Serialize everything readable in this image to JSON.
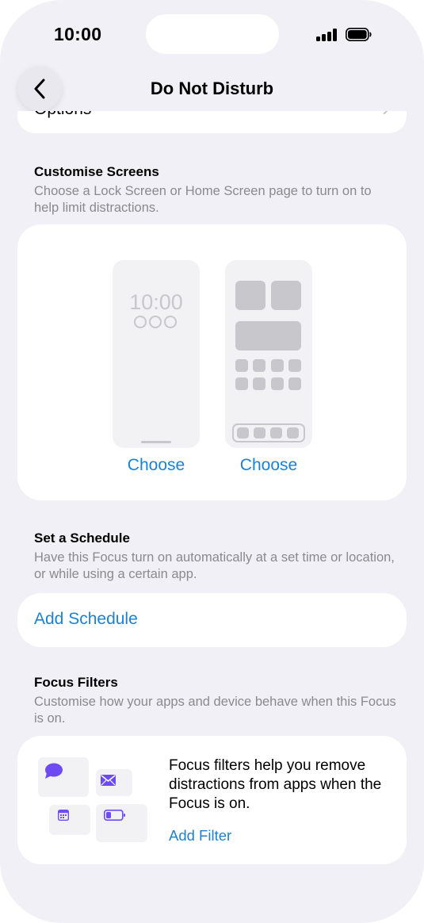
{
  "status": {
    "time": "10:00"
  },
  "nav": {
    "title": "Do Not Disturb"
  },
  "top_card": {
    "label": "Options"
  },
  "customise": {
    "title": "Customise Screens",
    "description": "Choose a Lock Screen or Home Screen page to turn on to help limit distractions.",
    "lock_time": "10:00",
    "choose_lock": "Choose",
    "choose_home": "Choose"
  },
  "schedule": {
    "title": "Set a Schedule",
    "description": "Have this Focus turn on automatically at a set time or location, or while using a certain app.",
    "add_label": "Add Schedule"
  },
  "filters": {
    "title": "Focus Filters",
    "description": "Customise how your apps and device behave when this Focus is on.",
    "info": "Focus filters help you remove distractions from apps when the Focus is on.",
    "add_label": "Add Filter"
  },
  "colors": {
    "accent": "#1a82d6",
    "filter_icon": "#6c4bf5",
    "background": "#f1f0f6"
  }
}
